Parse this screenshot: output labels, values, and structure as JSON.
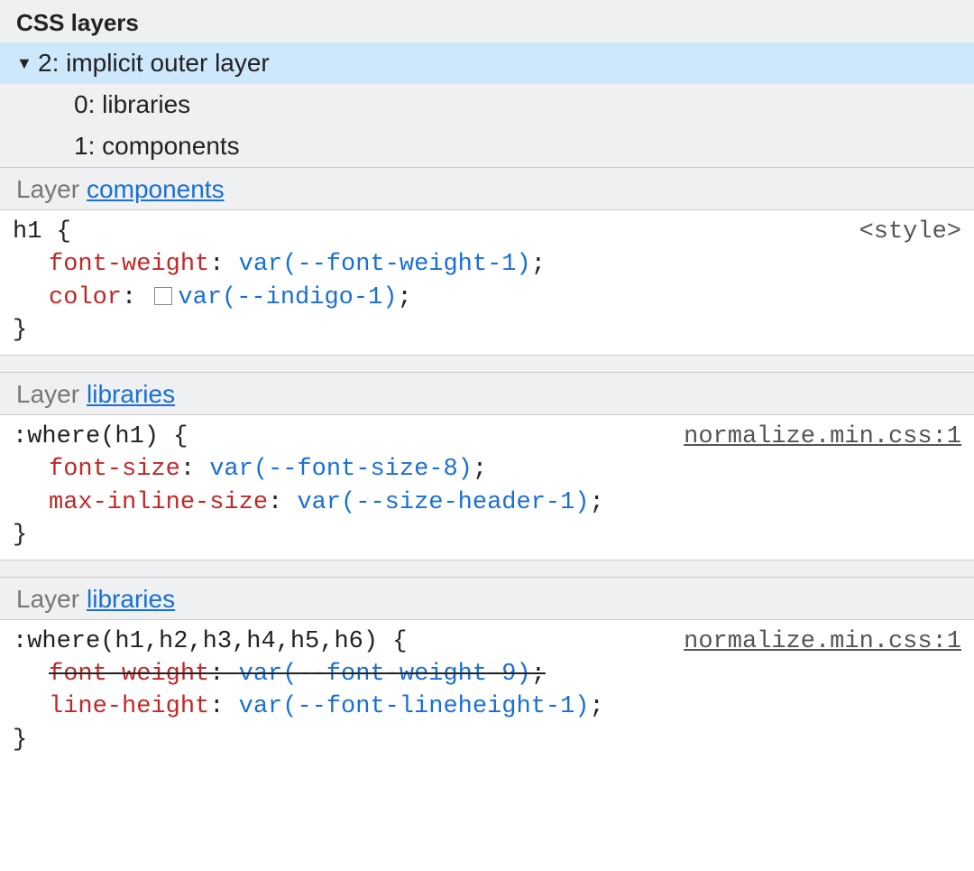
{
  "title": "CSS layers",
  "layersList": {
    "selected": "2: implicit outer layer",
    "children": [
      "0: libraries",
      "1: components"
    ]
  },
  "sections": [
    {
      "label_prefix": "Layer",
      "layer_link": "components",
      "selector": "h1",
      "brace_open": "{",
      "brace_close": "}",
      "source": "<style>",
      "source_underline": false,
      "decls": [
        {
          "prop": "font-weight",
          "value_var": "var(--font-weight-1)",
          "strike": false,
          "swatch": false
        },
        {
          "prop": "color",
          "value_var": "var(--indigo-1)",
          "strike": false,
          "swatch": true
        }
      ]
    },
    {
      "label_prefix": "Layer",
      "layer_link": "libraries",
      "selector": ":where(h1)",
      "brace_open": "{",
      "brace_close": "}",
      "source": "normalize.min.css:1",
      "source_underline": true,
      "decls": [
        {
          "prop": "font-size",
          "value_var": "var(--font-size-8)",
          "strike": false,
          "swatch": false
        },
        {
          "prop": "max-inline-size",
          "value_var": "var(--size-header-1)",
          "strike": false,
          "swatch": false
        }
      ]
    },
    {
      "label_prefix": "Layer",
      "layer_link": "libraries",
      "selector": ":where(h1,h2,h3,h4,h5,h6)",
      "brace_open": "{",
      "brace_close": "}",
      "source": "normalize.min.css:1",
      "source_underline": true,
      "decls": [
        {
          "prop": "font-weight",
          "value_var": "var(--font-weight-9)",
          "strike": true,
          "swatch": false
        },
        {
          "prop": "line-height",
          "value_var": "var(--font-lineheight-1)",
          "strike": false,
          "swatch": false
        }
      ]
    }
  ],
  "punct": {
    "colon": ":",
    "semicolon": ";"
  }
}
